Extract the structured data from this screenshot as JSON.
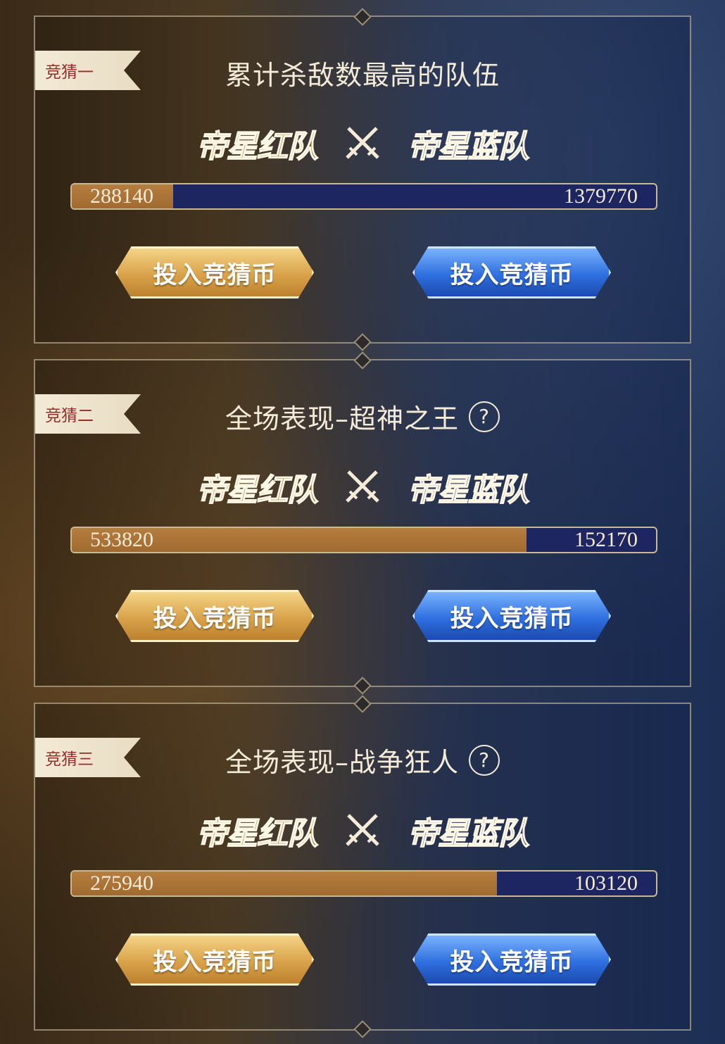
{
  "bets": [
    {
      "tag": "竞猜一",
      "title": "累计杀敌数最高的队伍",
      "has_help": false,
      "red_team": "帝星红队",
      "blue_team": "帝星蓝队",
      "red_value": "288140",
      "blue_value": "1379770",
      "red_share": 0.173,
      "red_button": "投入竞猜币",
      "blue_button": "投入竞猜币"
    },
    {
      "tag": "竞猜二",
      "title": "全场表现–超神之王",
      "has_help": true,
      "help_label": "?",
      "red_team": "帝星红队",
      "blue_team": "帝星蓝队",
      "red_value": "533820",
      "blue_value": "152170",
      "red_share": 0.778,
      "red_button": "投入竞猜币",
      "blue_button": "投入竞猜币"
    },
    {
      "tag": "竞猜三",
      "title": "全场表现–战争狂人",
      "has_help": true,
      "help_label": "?",
      "red_team": "帝星红队",
      "blue_team": "帝星蓝队",
      "red_value": "275940",
      "blue_value": "103120",
      "red_share": 0.728,
      "red_button": "投入竞猜币",
      "blue_button": "投入竞猜币"
    }
  ],
  "colors": {
    "red_fill": "#a16a30",
    "blue_fill": "#1d2660",
    "tag_text": "#9b2b2b"
  }
}
